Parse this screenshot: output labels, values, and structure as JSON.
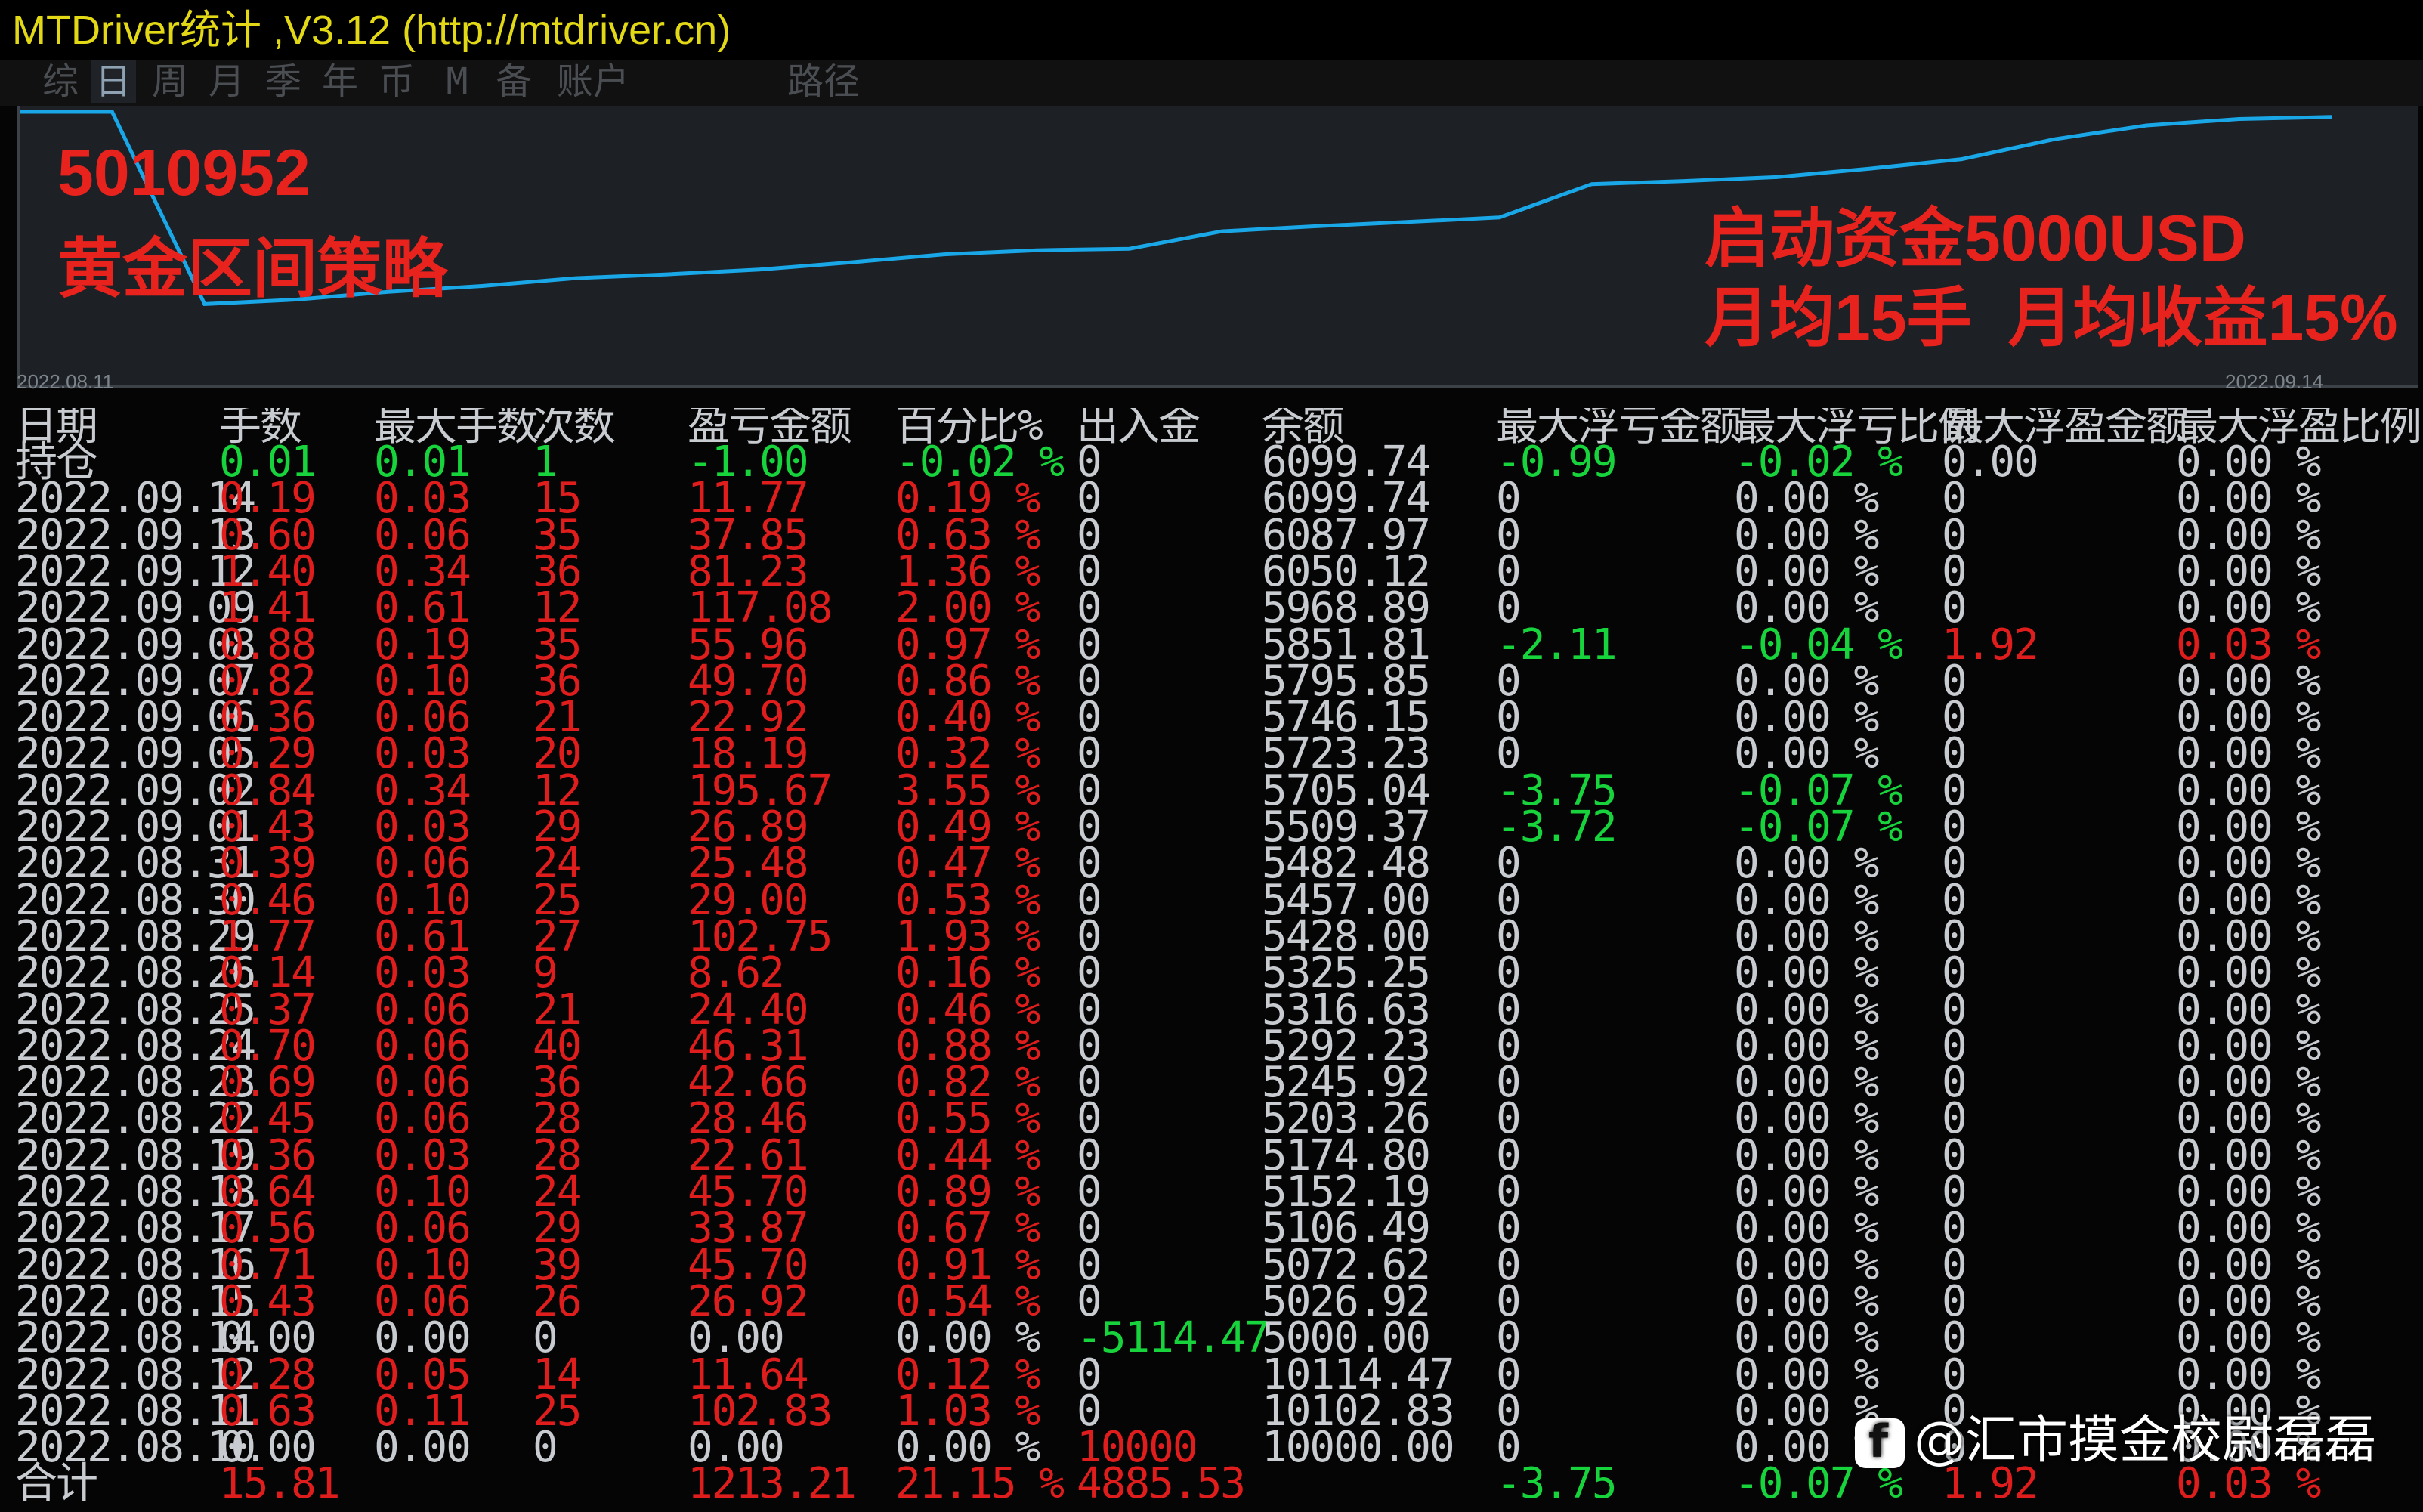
{
  "window": {
    "title": "MTDriver统计 ,V3.12 (http://mtdriver.cn)"
  },
  "tabs": [
    "综",
    "日",
    "周",
    "月",
    "季",
    "年",
    "币",
    "M",
    "备",
    "账户",
    "路径"
  ],
  "active_tab": "日",
  "chart": {
    "account": "5010952",
    "strategy": "黄金区间策略",
    "note_line1": "启动资金5000USD",
    "note_line2": "月均15手  月均收益15%",
    "date_start": "2022.08.11",
    "date_end": "2022.09.14",
    "line_color": "#1aa7e8"
  },
  "chart_data": {
    "type": "line",
    "x": [
      "2022.08.11",
      "2022.08.12",
      "2022.08.14",
      "2022.08.15",
      "2022.08.16",
      "2022.08.17",
      "2022.08.18",
      "2022.08.19",
      "2022.08.22",
      "2022.08.23",
      "2022.08.24",
      "2022.08.25",
      "2022.08.26",
      "2022.08.29",
      "2022.08.30",
      "2022.08.31",
      "2022.09.01",
      "2022.09.02",
      "2022.09.05",
      "2022.09.06",
      "2022.09.07",
      "2022.09.08",
      "2022.09.09",
      "2022.09.12",
      "2022.09.13",
      "2022.09.14"
    ],
    "y": [
      10102.83,
      10114.47,
      5000.0,
      5026.92,
      5072.62,
      5106.49,
      5152.19,
      5174.8,
      5203.26,
      5245.92,
      5292.23,
      5316.63,
      5325.25,
      5428.0,
      5457.0,
      5482.48,
      5509.37,
      5705.04,
      5723.23,
      5746.15,
      5795.85,
      5851.81,
      5968.89,
      6050.12,
      6087.97,
      6099.74
    ]
  },
  "table": {
    "headers": [
      "日期",
      "手数",
      "最大手数",
      "次数",
      "盈亏金额",
      "百分比%",
      "出入金",
      "余额",
      "最大浮亏金额",
      "最大浮亏比例",
      "最大浮盈金额",
      "最大浮盈比例"
    ],
    "rows": [
      [
        "持仓",
        "0.01",
        "0.01",
        "1",
        "-1.00",
        "-0.02 %",
        "0",
        "6099.74",
        "-0.99",
        "-0.02 %",
        "0.00",
        "0.00 %"
      ],
      [
        "2022.09.14",
        "0.19",
        "0.03",
        "15",
        "11.77",
        "0.19 %",
        "0",
        "6099.74",
        "0",
        "0.00 %",
        "0",
        "0.00 %"
      ],
      [
        "2022.09.13",
        "0.60",
        "0.06",
        "35",
        "37.85",
        "0.63 %",
        "0",
        "6087.97",
        "0",
        "0.00 %",
        "0",
        "0.00 %"
      ],
      [
        "2022.09.12",
        "1.40",
        "0.34",
        "36",
        "81.23",
        "1.36 %",
        "0",
        "6050.12",
        "0",
        "0.00 %",
        "0",
        "0.00 %"
      ],
      [
        "2022.09.09",
        "1.41",
        "0.61",
        "12",
        "117.08",
        "2.00 %",
        "0",
        "5968.89",
        "0",
        "0.00 %",
        "0",
        "0.00 %"
      ],
      [
        "2022.09.08",
        "0.88",
        "0.19",
        "35",
        "55.96",
        "0.97 %",
        "0",
        "5851.81",
        "-2.11",
        "-0.04 %",
        "1.92",
        "0.03 %"
      ],
      [
        "2022.09.07",
        "0.82",
        "0.10",
        "36",
        "49.70",
        "0.86 %",
        "0",
        "5795.85",
        "0",
        "0.00 %",
        "0",
        "0.00 %"
      ],
      [
        "2022.09.06",
        "0.36",
        "0.06",
        "21",
        "22.92",
        "0.40 %",
        "0",
        "5746.15",
        "0",
        "0.00 %",
        "0",
        "0.00 %"
      ],
      [
        "2022.09.05",
        "0.29",
        "0.03",
        "20",
        "18.19",
        "0.32 %",
        "0",
        "5723.23",
        "0",
        "0.00 %",
        "0",
        "0.00 %"
      ],
      [
        "2022.09.02",
        "0.84",
        "0.34",
        "12",
        "195.67",
        "3.55 %",
        "0",
        "5705.04",
        "-3.75",
        "-0.07 %",
        "0",
        "0.00 %"
      ],
      [
        "2022.09.01",
        "0.43",
        "0.03",
        "29",
        "26.89",
        "0.49 %",
        "0",
        "5509.37",
        "-3.72",
        "-0.07 %",
        "0",
        "0.00 %"
      ],
      [
        "2022.08.31",
        "0.39",
        "0.06",
        "24",
        "25.48",
        "0.47 %",
        "0",
        "5482.48",
        "0",
        "0.00 %",
        "0",
        "0.00 %"
      ],
      [
        "2022.08.30",
        "0.46",
        "0.10",
        "25",
        "29.00",
        "0.53 %",
        "0",
        "5457.00",
        "0",
        "0.00 %",
        "0",
        "0.00 %"
      ],
      [
        "2022.08.29",
        "1.77",
        "0.61",
        "27",
        "102.75",
        "1.93 %",
        "0",
        "5428.00",
        "0",
        "0.00 %",
        "0",
        "0.00 %"
      ],
      [
        "2022.08.26",
        "0.14",
        "0.03",
        "9",
        "8.62",
        "0.16 %",
        "0",
        "5325.25",
        "0",
        "0.00 %",
        "0",
        "0.00 %"
      ],
      [
        "2022.08.25",
        "0.37",
        "0.06",
        "21",
        "24.40",
        "0.46 %",
        "0",
        "5316.63",
        "0",
        "0.00 %",
        "0",
        "0.00 %"
      ],
      [
        "2022.08.24",
        "0.70",
        "0.06",
        "40",
        "46.31",
        "0.88 %",
        "0",
        "5292.23",
        "0",
        "0.00 %",
        "0",
        "0.00 %"
      ],
      [
        "2022.08.23",
        "0.69",
        "0.06",
        "36",
        "42.66",
        "0.82 %",
        "0",
        "5245.92",
        "0",
        "0.00 %",
        "0",
        "0.00 %"
      ],
      [
        "2022.08.22",
        "0.45",
        "0.06",
        "28",
        "28.46",
        "0.55 %",
        "0",
        "5203.26",
        "0",
        "0.00 %",
        "0",
        "0.00 %"
      ],
      [
        "2022.08.19",
        "0.36",
        "0.03",
        "28",
        "22.61",
        "0.44 %",
        "0",
        "5174.80",
        "0",
        "0.00 %",
        "0",
        "0.00 %"
      ],
      [
        "2022.08.18",
        "0.64",
        "0.10",
        "24",
        "45.70",
        "0.89 %",
        "0",
        "5152.19",
        "0",
        "0.00 %",
        "0",
        "0.00 %"
      ],
      [
        "2022.08.17",
        "0.56",
        "0.06",
        "29",
        "33.87",
        "0.67 %",
        "0",
        "5106.49",
        "0",
        "0.00 %",
        "0",
        "0.00 %"
      ],
      [
        "2022.08.16",
        "0.71",
        "0.10",
        "39",
        "45.70",
        "0.91 %",
        "0",
        "5072.62",
        "0",
        "0.00 %",
        "0",
        "0.00 %"
      ],
      [
        "2022.08.15",
        "0.43",
        "0.06",
        "26",
        "26.92",
        "0.54 %",
        "0",
        "5026.92",
        "0",
        "0.00 %",
        "0",
        "0.00 %"
      ],
      [
        "2022.08.14",
        "0.00",
        "0.00",
        "0",
        "0.00",
        "0.00 %",
        "-5114.47",
        "5000.00",
        "0",
        "0.00 %",
        "0",
        "0.00 %"
      ],
      [
        "2022.08.12",
        "0.28",
        "0.05",
        "14",
        "11.64",
        "0.12 %",
        "0",
        "10114.47",
        "0",
        "0.00 %",
        "0",
        "0.00 %"
      ],
      [
        "2022.08.11",
        "0.63",
        "0.11",
        "25",
        "102.83",
        "1.03 %",
        "0",
        "10102.83",
        "0",
        "0.00 %",
        "0",
        "0.00 %"
      ],
      [
        "2022.08.10",
        "0.00",
        "0.00",
        "0",
        "0.00",
        "0.00 %",
        "10000",
        "10000.00",
        "0",
        "0.00 %",
        "0",
        "0.00 %"
      ]
    ],
    "total": [
      "合计",
      "15.81",
      "",
      "",
      "1213.21",
      "21.15 %",
      "4885.53",
      "",
      "-3.75",
      "-0.07 %",
      "1.92",
      "0.03 %"
    ]
  },
  "watermark": "@汇市摸金校尉磊磊",
  "colors": {
    "positive": "#e01d1d",
    "negative": "#18d43c",
    "neutral": "#c8ccd0",
    "title": "#e2d816"
  }
}
